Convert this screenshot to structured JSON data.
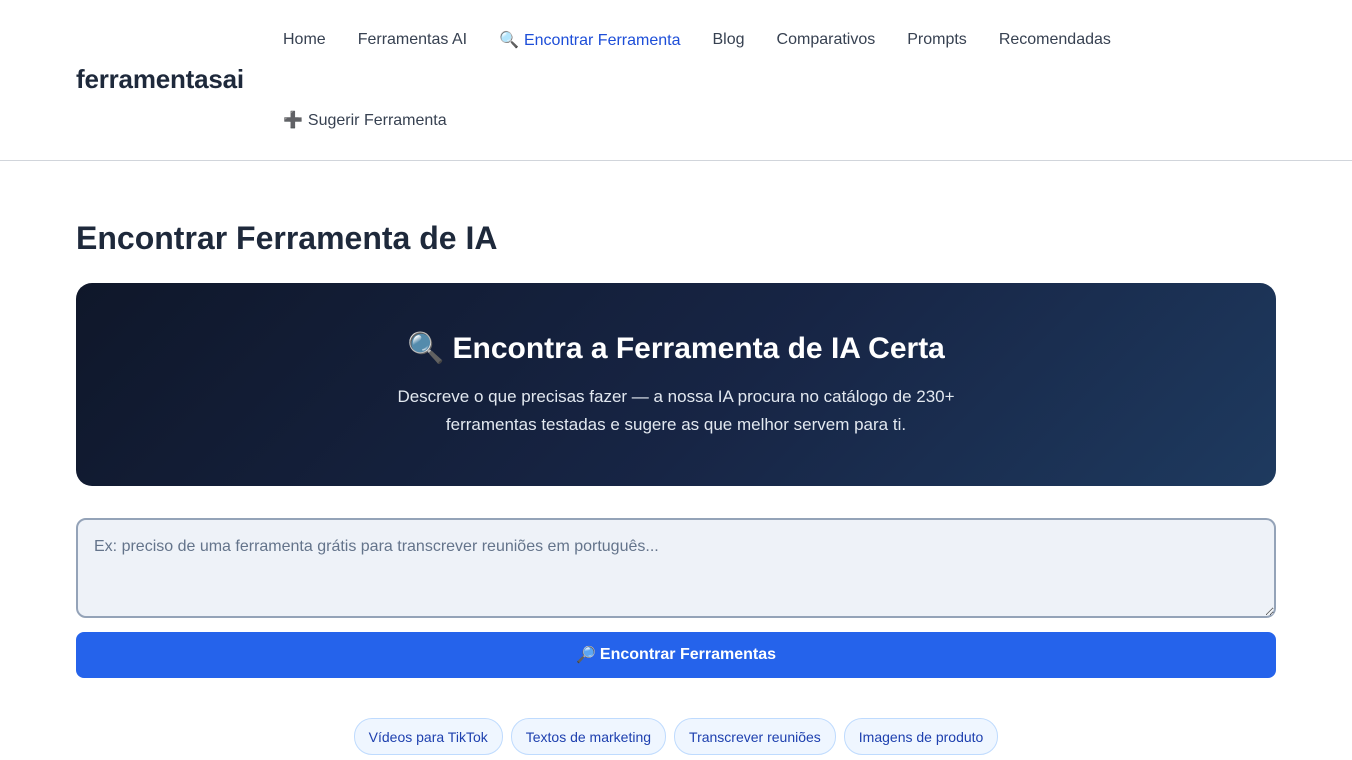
{
  "header": {
    "logo": "ferramentasai",
    "nav": [
      {
        "label": "Home",
        "glyph": "",
        "active": false
      },
      {
        "label": "Ferramentas AI",
        "glyph": "",
        "active": false
      },
      {
        "label": "Encontrar Ferramenta",
        "glyph": "🔍",
        "icon": "magnifier-left-icon",
        "active": true
      },
      {
        "label": "Blog",
        "glyph": "",
        "active": false
      },
      {
        "label": "Comparativos",
        "glyph": "",
        "active": false
      },
      {
        "label": "Prompts",
        "glyph": "",
        "active": false
      },
      {
        "label": "Recomendadas",
        "glyph": "",
        "active": false
      }
    ],
    "suggest": {
      "glyph": "➕",
      "icon": "plus-icon",
      "label": "Sugerir Ferramenta"
    }
  },
  "page": {
    "title": "Encontrar Ferramenta de IA"
  },
  "hero": {
    "glyph": "🔍",
    "icon": "magnifier-left-icon",
    "title": "Encontra a Ferramenta de IA Certa",
    "description": "Descreve o que precisas fazer — a nossa IA procura no catálogo de 230+ ferramentas testadas e sugere as que melhor servem para ti."
  },
  "search": {
    "value": "",
    "placeholder": "Ex: preciso de uma ferramenta grátis para transcrever reuniões em português..."
  },
  "find_button": {
    "glyph": "🔎",
    "icon": "magnifier-right-icon",
    "label": "Encontrar Ferramentas"
  },
  "suggestions": [
    "Vídeos para TikTok",
    "Textos de marketing",
    "Transcrever reuniões",
    "Imagens de produto"
  ],
  "colors": {
    "accent": "#2563eb",
    "active_link": "#1d4ed8",
    "hero_start": "#0f172a",
    "hero_end": "#1e3a5f",
    "chip_bg": "#eff6ff",
    "chip_text": "#1e40af"
  }
}
